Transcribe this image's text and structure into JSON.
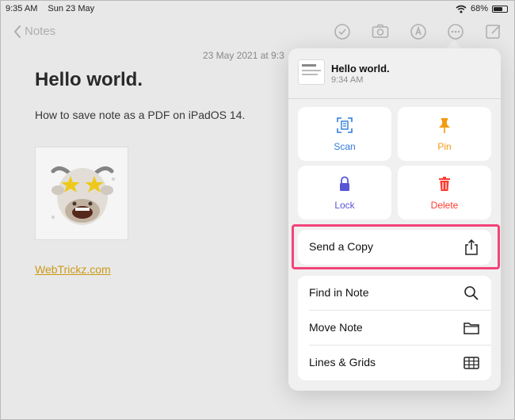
{
  "status_bar": {
    "time": "9:35 AM",
    "date": "Sun 23 May",
    "battery": "68%",
    "battery_level": 0.68
  },
  "nav": {
    "back_label": "Notes"
  },
  "note": {
    "date": "23 May 2021 at 9:3",
    "title": "Hello world.",
    "body": "How to save note as a PDF on iPadOS 14.",
    "link": "WebTrickz.com"
  },
  "popover": {
    "header": {
      "title": "Hello world.",
      "time": "9:34 AM"
    },
    "tiles": [
      {
        "label": "Scan",
        "icon": "scan-icon",
        "color": "#2f7bdc"
      },
      {
        "label": "Pin",
        "icon": "pin-icon",
        "color": "#f39c12"
      },
      {
        "label": "Lock",
        "icon": "lock-icon",
        "color": "#5856d6"
      },
      {
        "label": "Delete",
        "icon": "trash-icon",
        "color": "#ff3b30"
      }
    ],
    "send_copy": {
      "label": "Send a Copy",
      "icon": "share-icon"
    },
    "menu": [
      {
        "label": "Find in Note",
        "icon": "search-icon"
      },
      {
        "label": "Move Note",
        "icon": "folder-icon"
      },
      {
        "label": "Lines & Grids",
        "icon": "grid-icon"
      }
    ]
  },
  "colors": {
    "accent": "#d4a017",
    "highlight": "#f2447a",
    "toolbar_icon": "#b8b8b8"
  }
}
